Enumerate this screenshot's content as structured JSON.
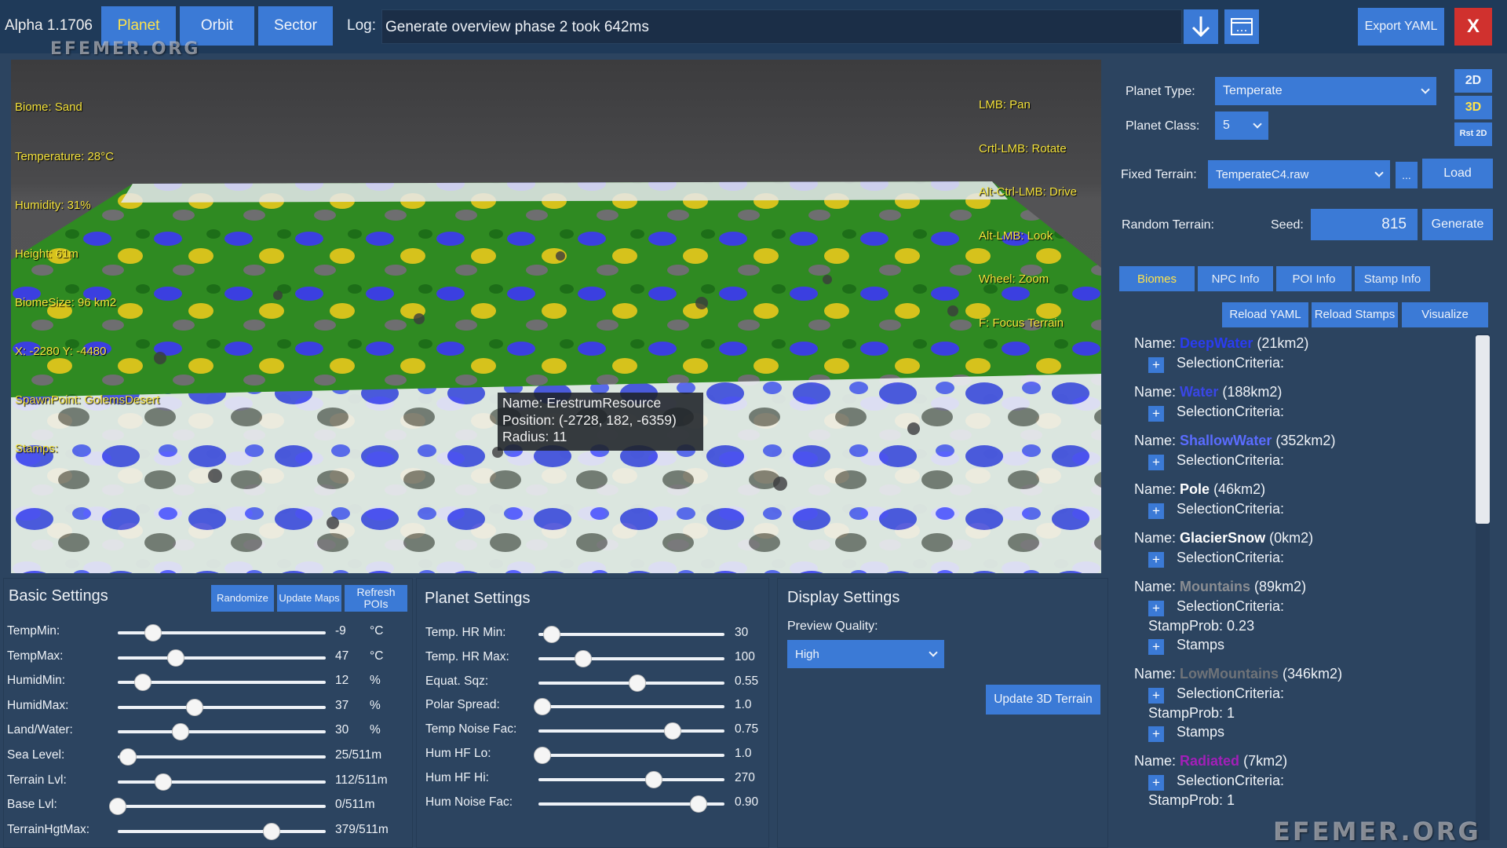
{
  "app": {
    "version": "Alpha 1.1706",
    "tabs": [
      "Planet",
      "Orbit",
      "Sector"
    ],
    "active_tab": "Planet",
    "log_label": "Log:",
    "log_message": "Generate overview phase 2 took 642ms",
    "export_label": "Export YAML",
    "close_label": "X",
    "watermark": "EFEMER.ORG"
  },
  "viewport": {
    "info_lines": [
      "Biome: Sand",
      "Temperature: 28°C",
      "Humidity: 31%",
      "Height: 61m",
      "BiomeSize: 96 km2",
      "X: -2280 Y: -4480",
      "SpawnPoint: GolemsDesert",
      "Stamps:"
    ],
    "controls": [
      "LMB: Pan",
      "Crtl-LMB: Rotate",
      "Alt-Ctrl-LMB: Drive",
      "Alt-LMB: Look",
      "Wheel: Zoom",
      "F: Focus Terrain"
    ],
    "tooltip": {
      "name": "Name: ErestrumResource",
      "position": "Position: (-2728, 182, -6359)",
      "radius": "Radius: 11"
    }
  },
  "planet_config": {
    "planet_type_label": "Planet Type:",
    "planet_type": "Temperate",
    "planet_class_label": "Planet Class:",
    "planet_class": "5",
    "view_2d": "2D",
    "view_3d": "3D",
    "rst_2d": "Rst 2D",
    "fixed_terrain_label": "Fixed Terrain:",
    "fixed_terrain": "TemperateC4.raw",
    "browse_label": "...",
    "load_label": "Load",
    "random_terrain_label": "Random Terrain:",
    "seed_label": "Seed:",
    "seed": "815",
    "generate_label": "Generate"
  },
  "info_tabs": [
    "Biomes",
    "NPC Info",
    "POI Info",
    "Stamp Info"
  ],
  "info_actions": [
    "Reload YAML",
    "Reload Stamps",
    "Visualize"
  ],
  "biomes": {
    "name_prefix": "Name:",
    "criteria_label": "SelectionCriteria:",
    "stamps_label": "Stamps",
    "items": [
      {
        "name": "DeepWater",
        "size": "(21km2)",
        "color": "#2a3cf0"
      },
      {
        "name": "Water",
        "size": "(188km2)",
        "color": "#3946e6"
      },
      {
        "name": "ShallowWater",
        "size": "(352km2)",
        "color": "#5a6cff"
      },
      {
        "name": "Pole",
        "size": "(46km2)",
        "color": "#ffffff"
      },
      {
        "name": "GlacierSnow",
        "size": "(0km2)",
        "color": "#ffffff"
      },
      {
        "name": "Mountains",
        "size": "(89km2)",
        "color": "#8a8d92",
        "stamp_prob": "StampProb: 0.23"
      },
      {
        "name": "LowMountains",
        "size": "(346km2)",
        "color": "#6f7378",
        "stamp_prob": "StampProb: 1"
      },
      {
        "name": "Radiated",
        "size": "(7km2)",
        "color": "#a21fb8",
        "stamp_prob": "StampProb: 1"
      }
    ]
  },
  "basic_settings": {
    "title": "Basic Settings",
    "randomize_label": "Randomize",
    "update_maps_label": "Update Maps",
    "refresh_pois_label": "Refresh POIs",
    "sliders": [
      {
        "label": "TempMin:",
        "value": "-9",
        "unit": "°C",
        "fraction": 0.17
      },
      {
        "label": "TempMax:",
        "value": "47",
        "unit": "°C",
        "fraction": 0.28
      },
      {
        "label": "HumidMin:",
        "value": "12",
        "unit": "%",
        "fraction": 0.12
      },
      {
        "label": "HumidMax:",
        "value": "37",
        "unit": "%",
        "fraction": 0.37
      },
      {
        "label": "Land/Water:",
        "value": "30",
        "unit": "%",
        "fraction": 0.3
      },
      {
        "label": "Sea Level:",
        "value": "25/511m",
        "unit": "",
        "fraction": 0.05
      },
      {
        "label": "Terrain Lvl:",
        "value": "112/511m",
        "unit": "",
        "fraction": 0.22
      },
      {
        "label": "Base Lvl:",
        "value": "0/511m",
        "unit": "",
        "fraction": 0.0
      },
      {
        "label": "TerrainHgtMax:",
        "value": "379/511m",
        "unit": "",
        "fraction": 0.74
      }
    ]
  },
  "planet_settings": {
    "title": "Planet Settings",
    "sliders": [
      {
        "label": "Temp. HR Min:",
        "value": "30",
        "fraction": 0.07
      },
      {
        "label": "Temp. HR Max:",
        "value": "100",
        "fraction": 0.24
      },
      {
        "label": "Equat. Sqz:",
        "value": "0.55",
        "fraction": 0.53
      },
      {
        "label": "Polar Spread:",
        "value": "1.0",
        "fraction": 0.02
      },
      {
        "label": "Temp Noise Fac:",
        "value": "0.75",
        "fraction": 0.72
      },
      {
        "label": "Hum HF Lo:",
        "value": "1.0",
        "fraction": 0.02
      },
      {
        "label": "Hum HF Hi:",
        "value": "270",
        "fraction": 0.62
      },
      {
        "label": "Hum Noise Fac:",
        "value": "0.90",
        "fraction": 0.86
      }
    ]
  },
  "display_settings": {
    "title": "Display Settings",
    "preview_quality_label": "Preview Quality:",
    "preview_quality": "High",
    "update_label": "Update 3D Terrain"
  },
  "colors": {
    "accent": "#3b7ad6",
    "active_tab_text": "#ffe34a",
    "overlay_text": "#f4e23a",
    "close": "#d0312e",
    "panel_bg": "#2c4460"
  }
}
